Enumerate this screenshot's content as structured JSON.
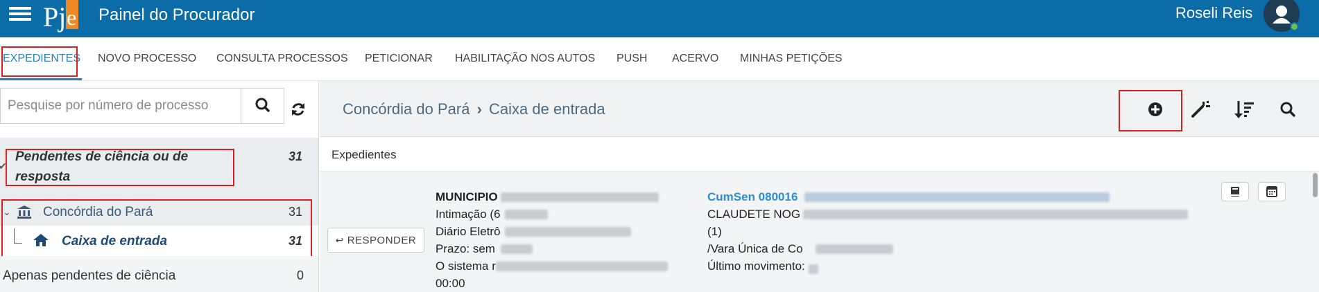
{
  "header": {
    "app_title": "Painel do Procurador",
    "user_name": "Roseli Reis",
    "logo_text": "PJe"
  },
  "nav": {
    "tabs": [
      "EXPEDIENTES",
      "NOVO PROCESSO",
      "CONSULTA PROCESSOS",
      "PETICIONAR",
      "HABILITAÇÃO NOS AUTOS",
      "PUSH",
      "ACERVO",
      "MINHAS PETIÇÕES"
    ],
    "active_tab": "EXPEDIENTES"
  },
  "sidebar": {
    "search_placeholder": "Pesquise por número de processo",
    "group": {
      "title": "Pendentes de ciência ou de resposta",
      "count": "31"
    },
    "items": [
      {
        "label": "Concórdia do Pará",
        "count": "31"
      },
      {
        "label": "Caixa de entrada",
        "count": "31"
      },
      {
        "label": "Apenas pendentes de ciência",
        "count": "0"
      }
    ]
  },
  "main": {
    "breadcrumb": {
      "location": "Concórdia do Pará",
      "separator": "›",
      "folder": "Caixa de entrada"
    },
    "section_title": "Expedientes",
    "expediente": {
      "respond_label": "RESPONDER",
      "left_lines": [
        "MUNICIPIO",
        "Intimação (6",
        "Diário Eletrô",
        "Prazo: sem",
        "O sistema r",
        "00:00"
      ],
      "right_lines": [
        "CumSen 080016",
        "CLAUDETE NOG",
        "(1)",
        "/Vara Única de Co",
        "Último movimento:"
      ]
    }
  },
  "colors": {
    "topbar": "#0b6ca8",
    "accent": "#2a7fb8",
    "highlight_box": "#d82020",
    "online": "#6bc04b"
  },
  "icons": [
    "menu-icon",
    "user-icon",
    "search-icon",
    "refresh-icon",
    "bank-icon",
    "home-icon",
    "add-circle-icon",
    "magic-wand-icon",
    "sort-icon",
    "calendar-icon",
    "book-icon",
    "reply-icon"
  ]
}
